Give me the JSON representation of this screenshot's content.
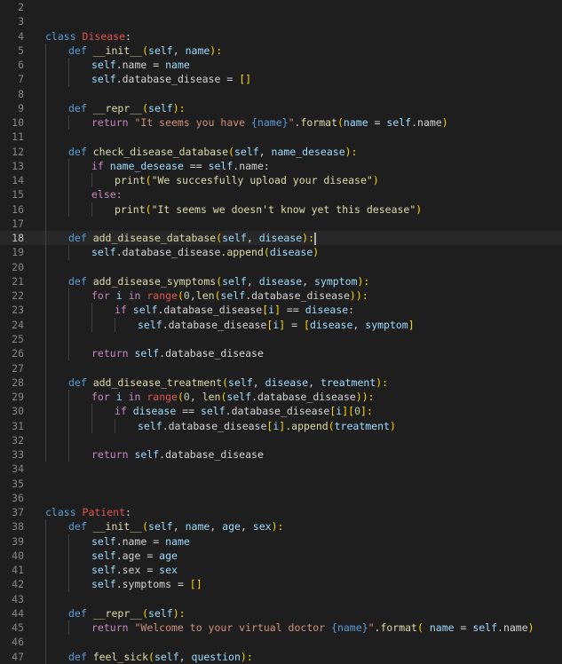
{
  "editor": {
    "language": "python",
    "cursor_line": 18,
    "lines": [
      {
        "n": "2",
        "indent": 0,
        "tokens": []
      },
      {
        "n": "3",
        "indent": 0,
        "tokens": []
      },
      {
        "n": "4",
        "indent": 0,
        "tokens": [
          {
            "t": "class ",
            "c": "kw"
          },
          {
            "t": "Disease",
            "c": "cls"
          },
          {
            "t": ":",
            "c": "plain"
          }
        ]
      },
      {
        "n": "5",
        "indent": 1,
        "tokens": [
          {
            "t": "def ",
            "c": "kw"
          },
          {
            "t": "__init__",
            "c": "fn"
          },
          {
            "t": "(",
            "c": "br"
          },
          {
            "t": "self",
            "c": "self"
          },
          {
            "t": ", ",
            "c": "plain"
          },
          {
            "t": "name",
            "c": "param"
          },
          {
            "t": "):",
            "c": "br"
          }
        ]
      },
      {
        "n": "6",
        "indent": 2,
        "tokens": [
          {
            "t": "self",
            "c": "self"
          },
          {
            "t": ".name = ",
            "c": "plain"
          },
          {
            "t": "name",
            "c": "param"
          }
        ]
      },
      {
        "n": "7",
        "indent": 2,
        "tokens": [
          {
            "t": "self",
            "c": "self"
          },
          {
            "t": ".database_disease = ",
            "c": "plain"
          },
          {
            "t": "[]",
            "c": "br"
          }
        ]
      },
      {
        "n": "8",
        "indent": 0,
        "tokens": []
      },
      {
        "n": "9",
        "indent": 1,
        "tokens": [
          {
            "t": "def ",
            "c": "kw"
          },
          {
            "t": "__repr__",
            "c": "fn"
          },
          {
            "t": "(",
            "c": "br"
          },
          {
            "t": "self",
            "c": "self"
          },
          {
            "t": "):",
            "c": "br"
          }
        ]
      },
      {
        "n": "10",
        "indent": 2,
        "tokens": [
          {
            "t": "return ",
            "c": "ctrl"
          },
          {
            "t": "\"It seems you have ",
            "c": "str"
          },
          {
            "t": "{name}",
            "c": "fmt"
          },
          {
            "t": "\"",
            "c": "str"
          },
          {
            "t": ".format",
            "c": "call"
          },
          {
            "t": "(",
            "c": "br"
          },
          {
            "t": "name",
            "c": "param"
          },
          {
            "t": " = ",
            "c": "plain"
          },
          {
            "t": "self",
            "c": "self"
          },
          {
            "t": ".name",
            "c": "plain"
          },
          {
            "t": ")",
            "c": "br"
          }
        ]
      },
      {
        "n": "11",
        "indent": 0,
        "tokens": []
      },
      {
        "n": "12",
        "indent": 1,
        "tokens": [
          {
            "t": "def ",
            "c": "kw"
          },
          {
            "t": "check_disease_database",
            "c": "fn"
          },
          {
            "t": "(",
            "c": "br"
          },
          {
            "t": "self",
            "c": "self"
          },
          {
            "t": ", ",
            "c": "plain"
          },
          {
            "t": "name_desease",
            "c": "param"
          },
          {
            "t": "):",
            "c": "br"
          }
        ]
      },
      {
        "n": "13",
        "indent": 2,
        "tokens": [
          {
            "t": "if ",
            "c": "ctrl"
          },
          {
            "t": "name_desease",
            "c": "param"
          },
          {
            "t": " == ",
            "c": "plain"
          },
          {
            "t": "self",
            "c": "self"
          },
          {
            "t": ".name:",
            "c": "plain"
          }
        ]
      },
      {
        "n": "14",
        "indent": 3,
        "tokens": [
          {
            "t": "print",
            "c": "bi"
          },
          {
            "t": "(",
            "c": "br"
          },
          {
            "t": "\"We succesfully upload your disease\"",
            "c": "str2"
          },
          {
            "t": ")",
            "c": "br"
          }
        ]
      },
      {
        "n": "15",
        "indent": 2,
        "tokens": [
          {
            "t": "else:",
            "c": "ctrl"
          }
        ]
      },
      {
        "n": "16",
        "indent": 3,
        "tokens": [
          {
            "t": "print",
            "c": "bi"
          },
          {
            "t": "(",
            "c": "br"
          },
          {
            "t": "\"It seems we doesn't know yet this desease\"",
            "c": "str2"
          },
          {
            "t": ")",
            "c": "br"
          }
        ]
      },
      {
        "n": "17",
        "indent": 0,
        "tokens": []
      },
      {
        "n": "18",
        "indent": 1,
        "tokens": [
          {
            "t": "def ",
            "c": "kw"
          },
          {
            "t": "add_disease_database",
            "c": "fn"
          },
          {
            "t": "(",
            "c": "br"
          },
          {
            "t": "self",
            "c": "self"
          },
          {
            "t": ", ",
            "c": "plain"
          },
          {
            "t": "disease",
            "c": "param"
          },
          {
            "t": "):",
            "c": "br"
          }
        ],
        "cursor": true
      },
      {
        "n": "19",
        "indent": 2,
        "tokens": [
          {
            "t": "self",
            "c": "self"
          },
          {
            "t": ".database_disease",
            "c": "plain"
          },
          {
            "t": ".append",
            "c": "call"
          },
          {
            "t": "(",
            "c": "br"
          },
          {
            "t": "disease",
            "c": "param"
          },
          {
            "t": ")",
            "c": "br"
          }
        ]
      },
      {
        "n": "20",
        "indent": 0,
        "tokens": []
      },
      {
        "n": "21",
        "indent": 1,
        "tokens": [
          {
            "t": "def ",
            "c": "kw"
          },
          {
            "t": "add_disease_symptoms",
            "c": "fn"
          },
          {
            "t": "(",
            "c": "br"
          },
          {
            "t": "self",
            "c": "self"
          },
          {
            "t": ", ",
            "c": "plain"
          },
          {
            "t": "disease",
            "c": "param"
          },
          {
            "t": ", ",
            "c": "plain"
          },
          {
            "t": "symptom",
            "c": "param"
          },
          {
            "t": "):",
            "c": "br"
          }
        ]
      },
      {
        "n": "22",
        "indent": 2,
        "tokens": [
          {
            "t": "for ",
            "c": "ctrl"
          },
          {
            "t": "i",
            "c": "param"
          },
          {
            "t": " in ",
            "c": "ctrl"
          },
          {
            "t": "range",
            "c": "range"
          },
          {
            "t": "(",
            "c": "br"
          },
          {
            "t": "0",
            "c": "num"
          },
          {
            "t": ",",
            "c": "plain"
          },
          {
            "t": "len",
            "c": "bi"
          },
          {
            "t": "(",
            "c": "br"
          },
          {
            "t": "self",
            "c": "self"
          },
          {
            "t": ".database_disease",
            "c": "plain"
          },
          {
            "t": ")):",
            "c": "br"
          }
        ]
      },
      {
        "n": "23",
        "indent": 3,
        "tokens": [
          {
            "t": "if ",
            "c": "ctrl"
          },
          {
            "t": "self",
            "c": "self"
          },
          {
            "t": ".database_disease",
            "c": "plain"
          },
          {
            "t": "[",
            "c": "br"
          },
          {
            "t": "i",
            "c": "param"
          },
          {
            "t": "]",
            "c": "br"
          },
          {
            "t": " == ",
            "c": "plain"
          },
          {
            "t": "disease",
            "c": "param"
          },
          {
            "t": ":",
            "c": "plain"
          }
        ]
      },
      {
        "n": "24",
        "indent": 4,
        "tokens": [
          {
            "t": "self",
            "c": "self"
          },
          {
            "t": ".database_disease",
            "c": "plain"
          },
          {
            "t": "[",
            "c": "br"
          },
          {
            "t": "i",
            "c": "param"
          },
          {
            "t": "]",
            "c": "br"
          },
          {
            "t": " = ",
            "c": "plain"
          },
          {
            "t": "[",
            "c": "br"
          },
          {
            "t": "disease",
            "c": "param"
          },
          {
            "t": ", ",
            "c": "plain"
          },
          {
            "t": "symptom",
            "c": "param"
          },
          {
            "t": "]",
            "c": "br"
          }
        ]
      },
      {
        "n": "25",
        "indent": 0,
        "tokens": []
      },
      {
        "n": "26",
        "indent": 2,
        "tokens": [
          {
            "t": "return ",
            "c": "ctrl"
          },
          {
            "t": "self",
            "c": "self"
          },
          {
            "t": ".database_disease",
            "c": "plain"
          }
        ]
      },
      {
        "n": "27",
        "indent": 0,
        "tokens": []
      },
      {
        "n": "28",
        "indent": 1,
        "tokens": [
          {
            "t": "def ",
            "c": "kw"
          },
          {
            "t": "add_disease_treatment",
            "c": "fn"
          },
          {
            "t": "(",
            "c": "br"
          },
          {
            "t": "self",
            "c": "self"
          },
          {
            "t": ", ",
            "c": "plain"
          },
          {
            "t": "disease",
            "c": "param"
          },
          {
            "t": ", ",
            "c": "plain"
          },
          {
            "t": "treatment",
            "c": "param"
          },
          {
            "t": "):",
            "c": "br"
          }
        ]
      },
      {
        "n": "29",
        "indent": 2,
        "tokens": [
          {
            "t": "for ",
            "c": "ctrl"
          },
          {
            "t": "i",
            "c": "param"
          },
          {
            "t": " in ",
            "c": "ctrl"
          },
          {
            "t": "range",
            "c": "range"
          },
          {
            "t": "(",
            "c": "br"
          },
          {
            "t": "0",
            "c": "num"
          },
          {
            "t": ", ",
            "c": "plain"
          },
          {
            "t": "len",
            "c": "bi"
          },
          {
            "t": "(",
            "c": "br"
          },
          {
            "t": "self",
            "c": "self"
          },
          {
            "t": ".database_disease",
            "c": "plain"
          },
          {
            "t": ")):",
            "c": "br"
          }
        ]
      },
      {
        "n": "30",
        "indent": 3,
        "tokens": [
          {
            "t": "if ",
            "c": "ctrl"
          },
          {
            "t": "disease",
            "c": "param"
          },
          {
            "t": " == ",
            "c": "plain"
          },
          {
            "t": "self",
            "c": "self"
          },
          {
            "t": ".database_disease",
            "c": "plain"
          },
          {
            "t": "[",
            "c": "br"
          },
          {
            "t": "i",
            "c": "param"
          },
          {
            "t": "][",
            "c": "br"
          },
          {
            "t": "0",
            "c": "num"
          },
          {
            "t": "]:",
            "c": "br"
          }
        ]
      },
      {
        "n": "31",
        "indent": 4,
        "tokens": [
          {
            "t": "self",
            "c": "self"
          },
          {
            "t": ".database_disease",
            "c": "plain"
          },
          {
            "t": "[",
            "c": "br"
          },
          {
            "t": "i",
            "c": "param"
          },
          {
            "t": "]",
            "c": "br"
          },
          {
            "t": ".append",
            "c": "call"
          },
          {
            "t": "(",
            "c": "br"
          },
          {
            "t": "treatment",
            "c": "param"
          },
          {
            "t": ")",
            "c": "br"
          }
        ]
      },
      {
        "n": "32",
        "indent": 0,
        "tokens": []
      },
      {
        "n": "33",
        "indent": 2,
        "tokens": [
          {
            "t": "return ",
            "c": "ctrl"
          },
          {
            "t": "self",
            "c": "self"
          },
          {
            "t": ".database_disease",
            "c": "plain"
          }
        ]
      },
      {
        "n": "34",
        "indent": 0,
        "tokens": []
      },
      {
        "n": "35",
        "indent": 0,
        "tokens": []
      },
      {
        "n": "36",
        "indent": 0,
        "tokens": []
      },
      {
        "n": "37",
        "indent": 0,
        "tokens": [
          {
            "t": "class ",
            "c": "kw"
          },
          {
            "t": "Patient",
            "c": "cls"
          },
          {
            "t": ":",
            "c": "plain"
          }
        ]
      },
      {
        "n": "38",
        "indent": 1,
        "tokens": [
          {
            "t": "def ",
            "c": "kw"
          },
          {
            "t": "__init__",
            "c": "fn"
          },
          {
            "t": "(",
            "c": "br"
          },
          {
            "t": "self",
            "c": "self"
          },
          {
            "t": ", ",
            "c": "plain"
          },
          {
            "t": "name",
            "c": "param"
          },
          {
            "t": ", ",
            "c": "plain"
          },
          {
            "t": "age",
            "c": "param"
          },
          {
            "t": ", ",
            "c": "plain"
          },
          {
            "t": "sex",
            "c": "param"
          },
          {
            "t": "):",
            "c": "br"
          }
        ]
      },
      {
        "n": "39",
        "indent": 2,
        "tokens": [
          {
            "t": "self",
            "c": "self"
          },
          {
            "t": ".name = ",
            "c": "plain"
          },
          {
            "t": "name",
            "c": "param"
          }
        ]
      },
      {
        "n": "40",
        "indent": 2,
        "tokens": [
          {
            "t": "self",
            "c": "self"
          },
          {
            "t": ".age = ",
            "c": "plain"
          },
          {
            "t": "age",
            "c": "param"
          }
        ]
      },
      {
        "n": "41",
        "indent": 2,
        "tokens": [
          {
            "t": "self",
            "c": "self"
          },
          {
            "t": ".sex = ",
            "c": "plain"
          },
          {
            "t": "sex",
            "c": "param"
          }
        ]
      },
      {
        "n": "42",
        "indent": 2,
        "tokens": [
          {
            "t": "self",
            "c": "self"
          },
          {
            "t": ".symptoms = ",
            "c": "plain"
          },
          {
            "t": "[]",
            "c": "br"
          }
        ]
      },
      {
        "n": "43",
        "indent": 0,
        "tokens": []
      },
      {
        "n": "44",
        "indent": 1,
        "tokens": [
          {
            "t": "def ",
            "c": "kw"
          },
          {
            "t": "__repr__",
            "c": "fn"
          },
          {
            "t": "(",
            "c": "br"
          },
          {
            "t": "self",
            "c": "self"
          },
          {
            "t": "):",
            "c": "br"
          }
        ]
      },
      {
        "n": "45",
        "indent": 2,
        "tokens": [
          {
            "t": "return ",
            "c": "ctrl"
          },
          {
            "t": "\"Welcome to your virtual doctor ",
            "c": "str"
          },
          {
            "t": "{name}",
            "c": "fmt"
          },
          {
            "t": "\"",
            "c": "str"
          },
          {
            "t": ".format",
            "c": "call"
          },
          {
            "t": "( ",
            "c": "br"
          },
          {
            "t": "name",
            "c": "param"
          },
          {
            "t": " = ",
            "c": "plain"
          },
          {
            "t": "self",
            "c": "self"
          },
          {
            "t": ".name",
            "c": "plain"
          },
          {
            "t": ")",
            "c": "br"
          }
        ]
      },
      {
        "n": "46",
        "indent": 0,
        "tokens": []
      },
      {
        "n": "47",
        "indent": 1,
        "tokens": [
          {
            "t": "def ",
            "c": "kw"
          },
          {
            "t": "feel_sick",
            "c": "fn"
          },
          {
            "t": "(",
            "c": "br"
          },
          {
            "t": "self",
            "c": "self"
          },
          {
            "t": ", ",
            "c": "plain"
          },
          {
            "t": "question",
            "c": "param"
          },
          {
            "t": "):",
            "c": "br"
          }
        ]
      }
    ]
  }
}
